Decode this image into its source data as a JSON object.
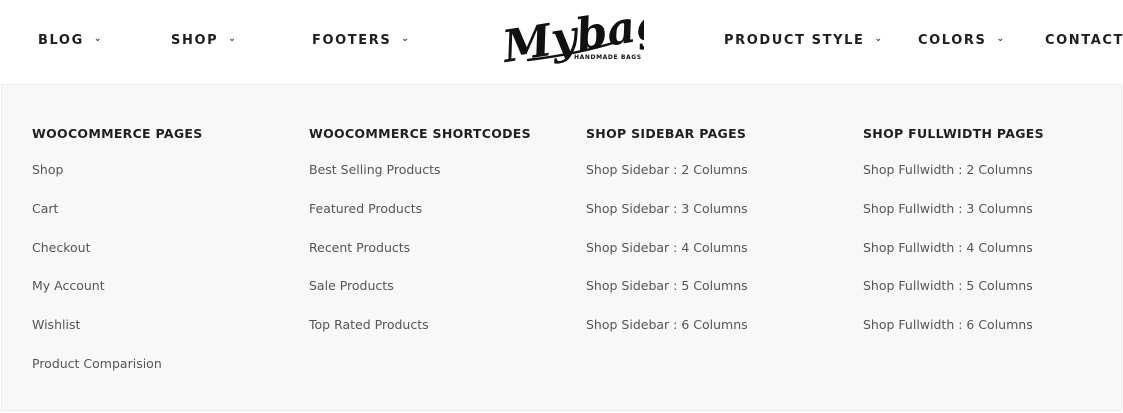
{
  "nav": {
    "left": [
      {
        "label": "BLOG",
        "chevron": "⌄"
      },
      {
        "label": "SHOP",
        "chevron": "⌄"
      },
      {
        "label": "FOOTERS",
        "chevron": "⌄"
      }
    ],
    "right": [
      {
        "label": "PRODUCT STYLE",
        "chevron": "⌄"
      },
      {
        "label": "COLORS",
        "chevron": "⌄"
      },
      {
        "label": "CONTACT"
      }
    ]
  },
  "logo": {
    "text": "Mybag",
    "tagline": "HANDMADE BAGS"
  },
  "mega_menu": {
    "columns": [
      {
        "title": "WOOCOMMERCE PAGES",
        "items": [
          "Shop",
          "Cart",
          "Checkout",
          "My Account",
          "Wishlist",
          "Product Comparision"
        ]
      },
      {
        "title": "WOOCOMMERCE SHORTCODES",
        "items": [
          "Best Selling Products",
          "Featured Products",
          "Recent Products",
          "Sale Products",
          "Top Rated Products"
        ]
      },
      {
        "title": "SHOP SIDEBAR PAGES",
        "items": [
          "Shop Sidebar : 2 Columns",
          "Shop Sidebar : 3 Columns",
          "Shop Sidebar : 4 Columns",
          "Shop Sidebar : 5 Columns",
          "Shop Sidebar : 6 Columns"
        ]
      },
      {
        "title": "SHOP FULLWIDTH PAGES",
        "items": [
          "Shop Fullwidth : 2 Columns",
          "Shop Fullwidth : 3 Columns",
          "Shop Fullwidth : 4 Columns",
          "Shop Fullwidth : 5 Columns",
          "Shop Fullwidth : 6 Columns"
        ]
      }
    ]
  }
}
